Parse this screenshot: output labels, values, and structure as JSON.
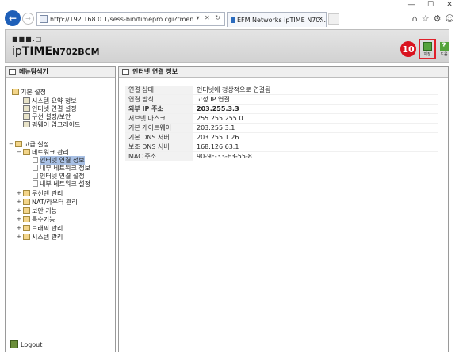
{
  "browser": {
    "url": "http://192.168.0.1/sess-bin/timepro.cgi?tmenu=main_frame&smenu=main_frame",
    "tab_title": "EFM Networks ipTIME N70...",
    "tab_close": "×",
    "nav_back": "←",
    "nav_forward": "→",
    "window_controls": [
      "—",
      "☐",
      "✕"
    ],
    "toolbar_icons": [
      "home-icon",
      "star-icon",
      "gear-icon",
      "smiley-icon"
    ]
  },
  "header": {
    "logo_dots": "■■■.□",
    "logo_brand_prefix": "ip",
    "logo_brand": "TIME",
    "logo_model": "N702BCM",
    "step_badge": "10",
    "save_label": "저장",
    "help_label": "도움"
  },
  "sidebar": {
    "title": "메뉴탐색기",
    "basic_settings": "기본 설정",
    "basic_items": [
      "시스템 요약 정보",
      "인터넷 연결 설정",
      "무선 설정/보안",
      "펌웨어 업그레이드"
    ],
    "advanced_settings": "고급 설정",
    "network_management": "네트워크 관리",
    "network_items": [
      "인터넷 연결 정보",
      "내부 네트워크 정보",
      "인터넷 연결 설정",
      "내부 네트워크 설정"
    ],
    "advanced_items": [
      "무선랜 관리",
      "NAT/라우터 관리",
      "보안 기능",
      "특수기능",
      "트래픽 관리",
      "시스템 관리"
    ],
    "logout": "Logout"
  },
  "main": {
    "title": "인터넷 연결 정보",
    "rows": [
      {
        "label": "연결 상태",
        "value": "인터넷에 정상적으로 연결됨"
      },
      {
        "label": "연결 방식",
        "value": "고정 IP 연결"
      },
      {
        "label": "외부 IP 주소",
        "value": "203.255.3.3"
      },
      {
        "label": "서브넷 마스크",
        "value": "255.255.255.0"
      },
      {
        "label": "기본 게이트웨이",
        "value": "203.255.3.1"
      },
      {
        "label": "기본 DNS 서버",
        "value": "203.255.1.26"
      },
      {
        "label": "보조 DNS 서버",
        "value": "168.126.63.1"
      },
      {
        "label": "MAC 주소",
        "value": "90-9F-33-E3-55-81"
      }
    ]
  }
}
